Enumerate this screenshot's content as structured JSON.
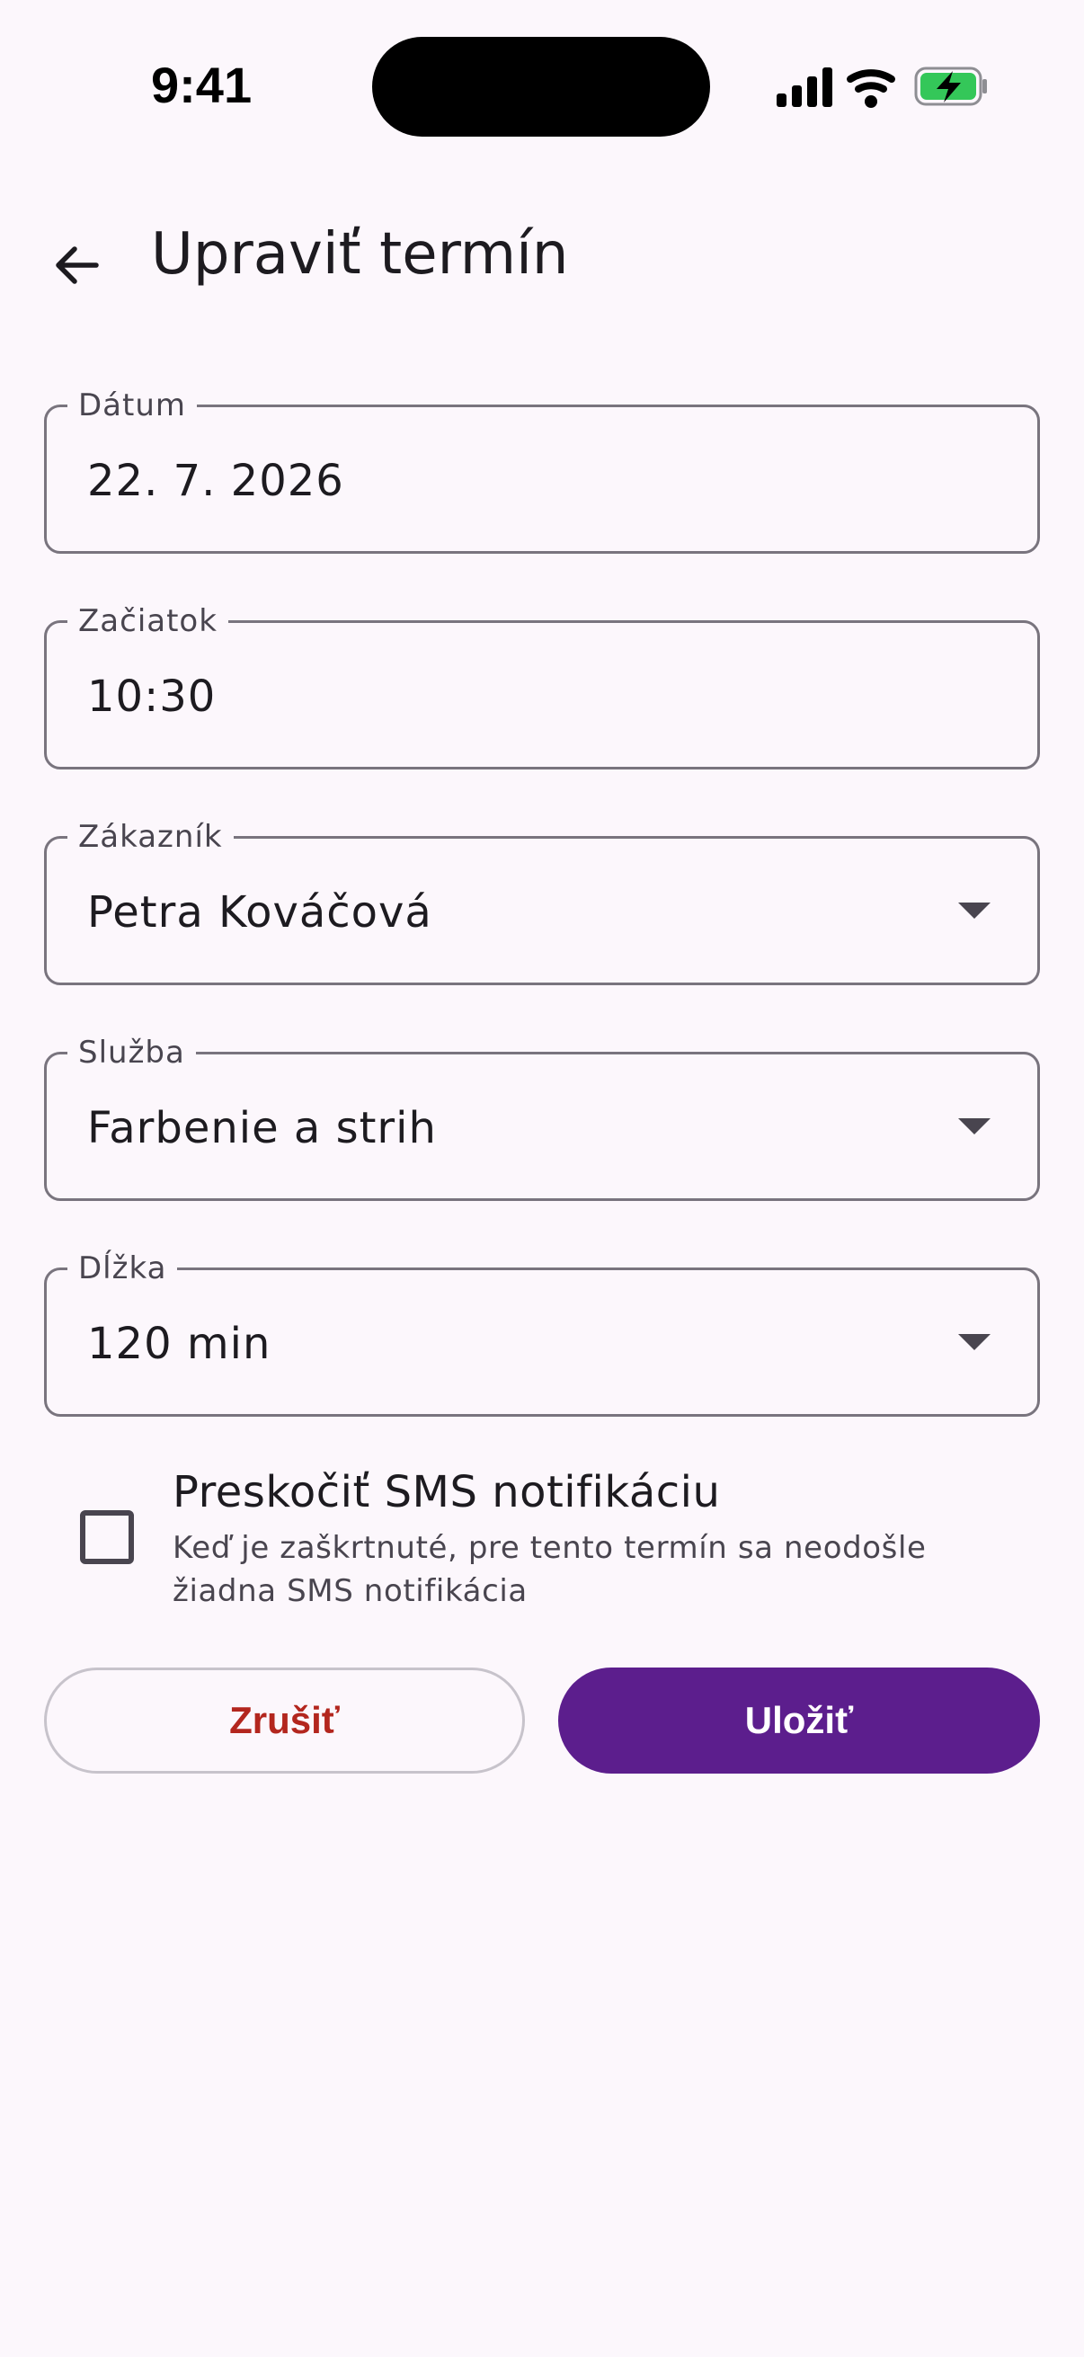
{
  "status_bar": {
    "time": "9:41",
    "icons": [
      "cellular-signal-icon",
      "wifi-icon",
      "battery-charging-icon"
    ],
    "battery_color": "#34c759"
  },
  "app_bar": {
    "back_icon": "arrow-back-icon",
    "title": "Upraviť termín"
  },
  "form": {
    "date": {
      "label": "Dátum",
      "value": "22. 7. 2026"
    },
    "start": {
      "label": "Začiatok",
      "value": "10:30"
    },
    "customer": {
      "label": "Zákazník",
      "value": "Petra Kováčová",
      "type": "dropdown"
    },
    "service": {
      "label": "Služba",
      "value": "Farbenie a strih",
      "type": "dropdown"
    },
    "duration": {
      "label": "Dĺžka",
      "value": "120 min",
      "type": "dropdown"
    },
    "skip_sms": {
      "checked": false,
      "title": "Preskočiť SMS notifikáciu",
      "subtitle": "Keď je zaškrtnuté, pre tento termín sa neodošle žiadna SMS notifikácia"
    }
  },
  "actions": {
    "cancel_label": "Zrušiť",
    "save_label": "Uložiť"
  },
  "colors": {
    "background": "#fcf7fc",
    "primary": "#5c1e8d",
    "error": "#b3261e",
    "outline": "#79747e"
  }
}
